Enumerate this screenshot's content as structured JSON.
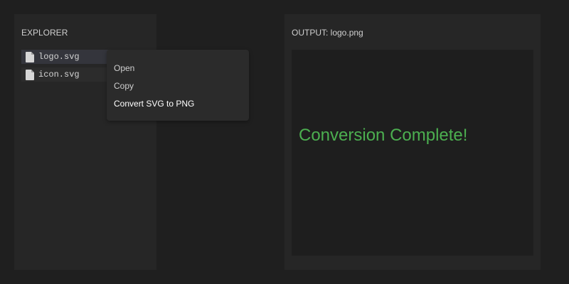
{
  "explorer": {
    "title": "EXPLORER",
    "files": [
      {
        "name": "logo.svg",
        "icon": "file-icon",
        "selected": true
      },
      {
        "name": "icon.svg",
        "icon": "file-icon",
        "selected": false
      }
    ]
  },
  "context_menu": {
    "items": [
      {
        "label": "Open"
      },
      {
        "label": "Copy"
      },
      {
        "label": "Convert SVG to PNG"
      }
    ]
  },
  "output": {
    "title": "OUTPUT: logo.png",
    "status": "Conversion Complete!",
    "status_color": "#4caf50"
  },
  "colors": {
    "background": "#1f1f1f",
    "panel": "#262626",
    "selected_item": "#34353c",
    "menu": "#2b2b2b",
    "success": "#4caf50"
  }
}
